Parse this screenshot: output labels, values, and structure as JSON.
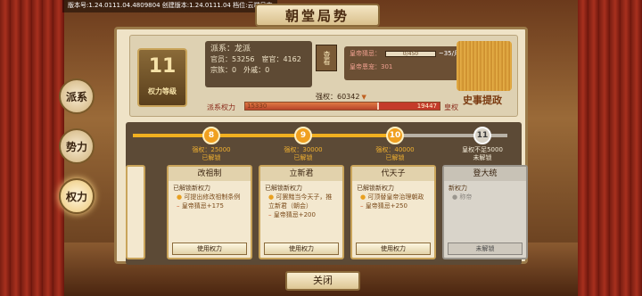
{
  "version_bar": "版本号:1.24.0111.04.4809804  创建版本:1.24.0111.04  档位:云端日志",
  "title": "朝堂局势",
  "side_tabs": [
    {
      "label": "派系"
    },
    {
      "label": "势力"
    },
    {
      "label": "权力"
    }
  ],
  "rank": {
    "number": "11",
    "label": "权力等级"
  },
  "faction": {
    "name": "派系：龙派",
    "officials_label": "官员：53256",
    "eunuch_label": "宦官：4162",
    "clan_label": "宗族：0",
    "consort_label": "外戚：0"
  },
  "seal_view_label": "查看",
  "emperor": {
    "suspicion_label": "皇帝猜忌：",
    "suspicion_value": "0/450",
    "suspicion_fraction": 0,
    "suspicion_suffix": "~35/月",
    "favor_label": "皇帝恩宠：301"
  },
  "book_label": "史事提政",
  "power": {
    "top_label": "强权：60342",
    "faction_power_label": "派系权力",
    "faction_value": "15330",
    "emperor_value": "19447",
    "emperor_power_label": "皇权",
    "faction_fraction": 0.68
  },
  "levels": [
    {
      "number": "8",
      "cap_line1": "强权：25000",
      "cap_line2": "已解锁",
      "locked": false
    },
    {
      "number": "9",
      "cap_line1": "强权：30000",
      "cap_line2": "已解锁",
      "locked": false
    },
    {
      "number": "10",
      "cap_line1": "强权：40000",
      "cap_line2": "已解锁",
      "locked": false
    },
    {
      "number": "11",
      "cap_line1": "皇权不足5000",
      "cap_line2": "未解锁",
      "locked": true
    }
  ],
  "cards": [
    {
      "title": "改祖制",
      "unlocked_title": "已解锁新权力",
      "bullet": "可提出修改祖制条例",
      "effect": "皇帝猜忌+175",
      "button": "使用权力"
    },
    {
      "title": "立新君",
      "unlocked_title": "已解锁新权力",
      "bullet": "可罢黜当今天子，推立新君（朝会）",
      "effect": "皇帝猜忌+200",
      "button": "使用权力"
    },
    {
      "title": "代天子",
      "unlocked_title": "已解锁新权力",
      "bullet": "可顶替皇帝治理朝政",
      "effect": "皇帝猜忌+250",
      "button": "使用权力"
    },
    {
      "title": "登大统",
      "unlocked_title": "新权力",
      "bullet": "称帝",
      "button": "未解锁"
    }
  ],
  "close_button": "关闭",
  "colors": {
    "gold": "#f0a020",
    "panel": "#efe3c7",
    "dark_box": "#5c4a36",
    "power_red": "#c43a2a"
  }
}
